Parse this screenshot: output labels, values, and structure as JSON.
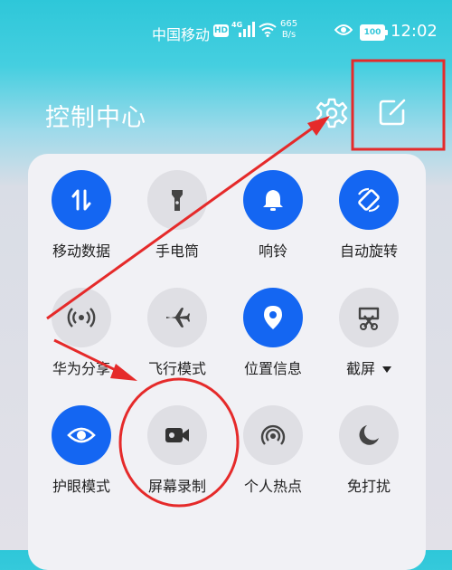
{
  "status_bar": {
    "carrier": "中国移动",
    "hd_badge": "HD",
    "network": "4G",
    "speed_value": "665",
    "speed_unit": "B/s",
    "battery": "100",
    "time": "12:02"
  },
  "header": {
    "title": "控制中心"
  },
  "tiles": [
    {
      "label": "移动数据",
      "icon": "mobile-data-icon",
      "active": true
    },
    {
      "label": "手电筒",
      "icon": "flashlight-icon",
      "active": false
    },
    {
      "label": "响铃",
      "icon": "bell-icon",
      "active": true
    },
    {
      "label": "自动旋转",
      "icon": "auto-rotate-icon",
      "active": true
    },
    {
      "label": "华为分享",
      "icon": "huawei-share-icon",
      "active": false
    },
    {
      "label": "飞行模式",
      "icon": "airplane-icon",
      "active": false
    },
    {
      "label": "位置信息",
      "icon": "location-icon",
      "active": true
    },
    {
      "label": "截屏",
      "icon": "screenshot-icon",
      "active": false,
      "has_dropdown": true
    },
    {
      "label": "护眼模式",
      "icon": "eye-comfort-icon",
      "active": true
    },
    {
      "label": "屏幕录制",
      "icon": "screen-record-icon",
      "active": false
    },
    {
      "label": "个人热点",
      "icon": "hotspot-icon",
      "active": false
    },
    {
      "label": "免打扰",
      "icon": "moon-icon",
      "active": false
    }
  ],
  "colors": {
    "accent": "#1466f2",
    "tile_off": "#dfdfe4",
    "annotation": "#e52a2a"
  }
}
